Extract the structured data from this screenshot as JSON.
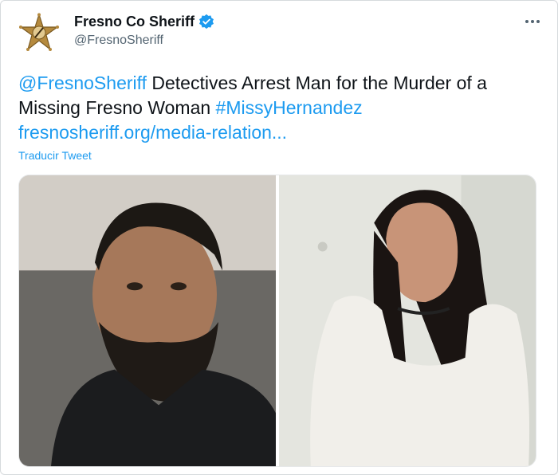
{
  "tweet": {
    "author": {
      "display_name": "Fresno Co Sheriff",
      "handle": "@FresnoSheriff",
      "verified": true,
      "avatar_icon": "sheriff-star-icon"
    },
    "text": {
      "mention": "@FresnoSheriff",
      "body": " Detectives Arrest Man for the Murder of a Missing Fresno Woman ",
      "hashtag": "#MissyHernandez",
      "url": "fresnosheriff.org/media-relation..."
    },
    "translate_label": "Traducir Tweet",
    "more_icon": "ellipsis-icon",
    "colors": {
      "link": "#1d9bf0",
      "text": "#0f1419",
      "secondary": "#536471"
    }
  }
}
